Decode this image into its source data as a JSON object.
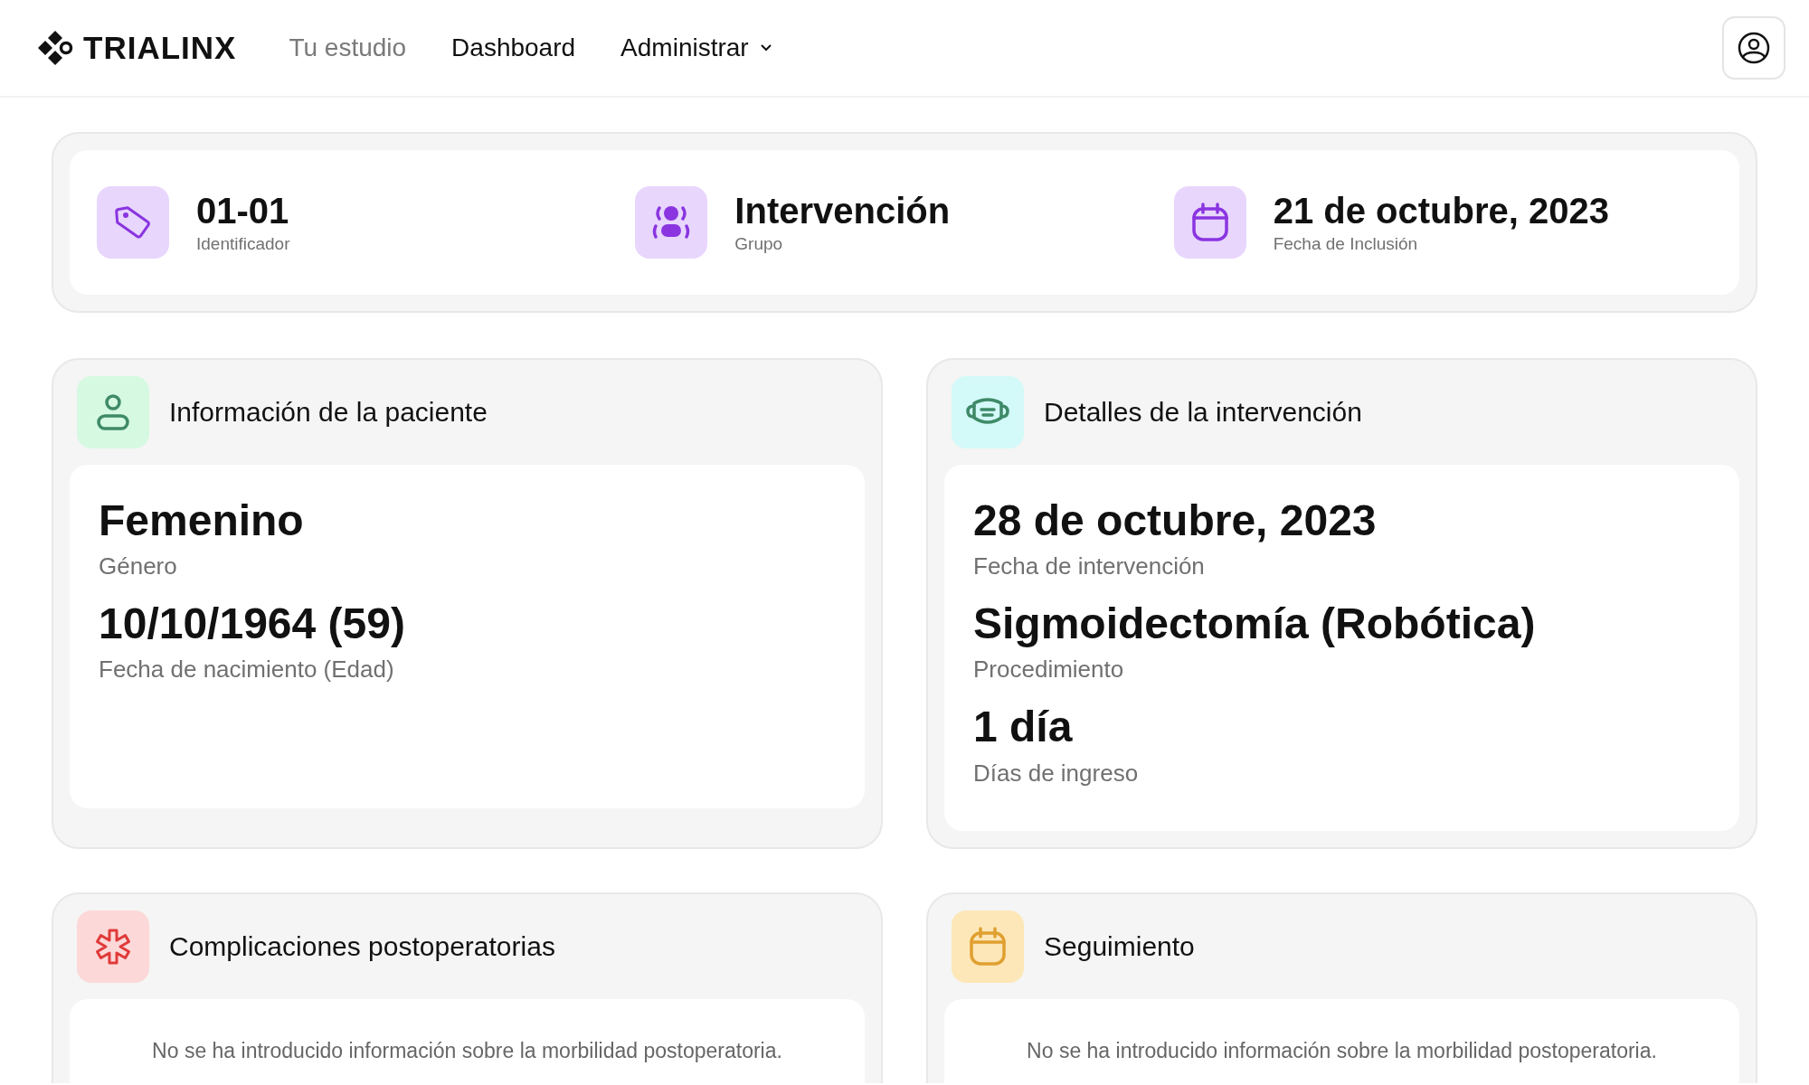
{
  "brand": "TRIALINX",
  "nav": [
    {
      "label": "Tu estudio",
      "dimmed": true
    },
    {
      "label": "Dashboard",
      "dimmed": false
    },
    {
      "label": "Administrar",
      "dimmed": false,
      "dropdown": true
    }
  ],
  "summary": [
    {
      "value": "01-01",
      "label": "Identificador"
    },
    {
      "value": "Intervención",
      "label": "Grupo"
    },
    {
      "value": "21 de octubre, 2023",
      "label": "Fecha de Inclusión"
    }
  ],
  "sections": [
    {
      "title": "Información de la paciente",
      "color": "#d6f9e2",
      "kind": "fields",
      "fields": [
        {
          "value": "Femenino",
          "label": "Género"
        },
        {
          "value": "10/10/1964 (59)",
          "label": "Fecha de nacimiento (Edad)"
        }
      ]
    },
    {
      "title": "Detalles de la intervención",
      "color": "#d3f9f8",
      "kind": "fields",
      "fields": [
        {
          "value": "28 de octubre, 2023",
          "label": "Fecha de intervención"
        },
        {
          "value": "Sigmoidectomía (Robótica)",
          "label": "Procedimiento"
        },
        {
          "value": "1 día",
          "label": "Días de ingreso"
        }
      ]
    },
    {
      "title": "Complicaciones postoperatorias",
      "color": "#fdd8d8",
      "kind": "empty",
      "message": "No se ha introducido información sobre la morbilidad postoperatoria."
    },
    {
      "title": "Seguimiento",
      "color": "#fde7b8",
      "kind": "empty",
      "message": "No se ha introducido información sobre la morbilidad postoperatoria."
    }
  ]
}
